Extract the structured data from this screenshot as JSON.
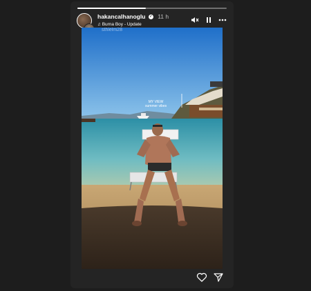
{
  "story": {
    "username": "hakancalhanoglu",
    "time": "11 h",
    "music": "Burna Boy - Update",
    "watermark": "sthlelm28",
    "sticker": "MY VIEW",
    "sticker_sub": "summer vibes",
    "progress": 0.46
  },
  "controls": {
    "mute_icon": "speaker-muted-icon",
    "pause_icon": "pause-icon",
    "more_icon": "more-icon"
  },
  "footer": {
    "like_icon": "heart-icon",
    "share_icon": "send-icon"
  },
  "colors": {
    "background": "#1d1d1d",
    "frame": "#242424",
    "sky": "#3a8fd6",
    "sea": "#5bb1c6",
    "sand": "#c49c63"
  }
}
